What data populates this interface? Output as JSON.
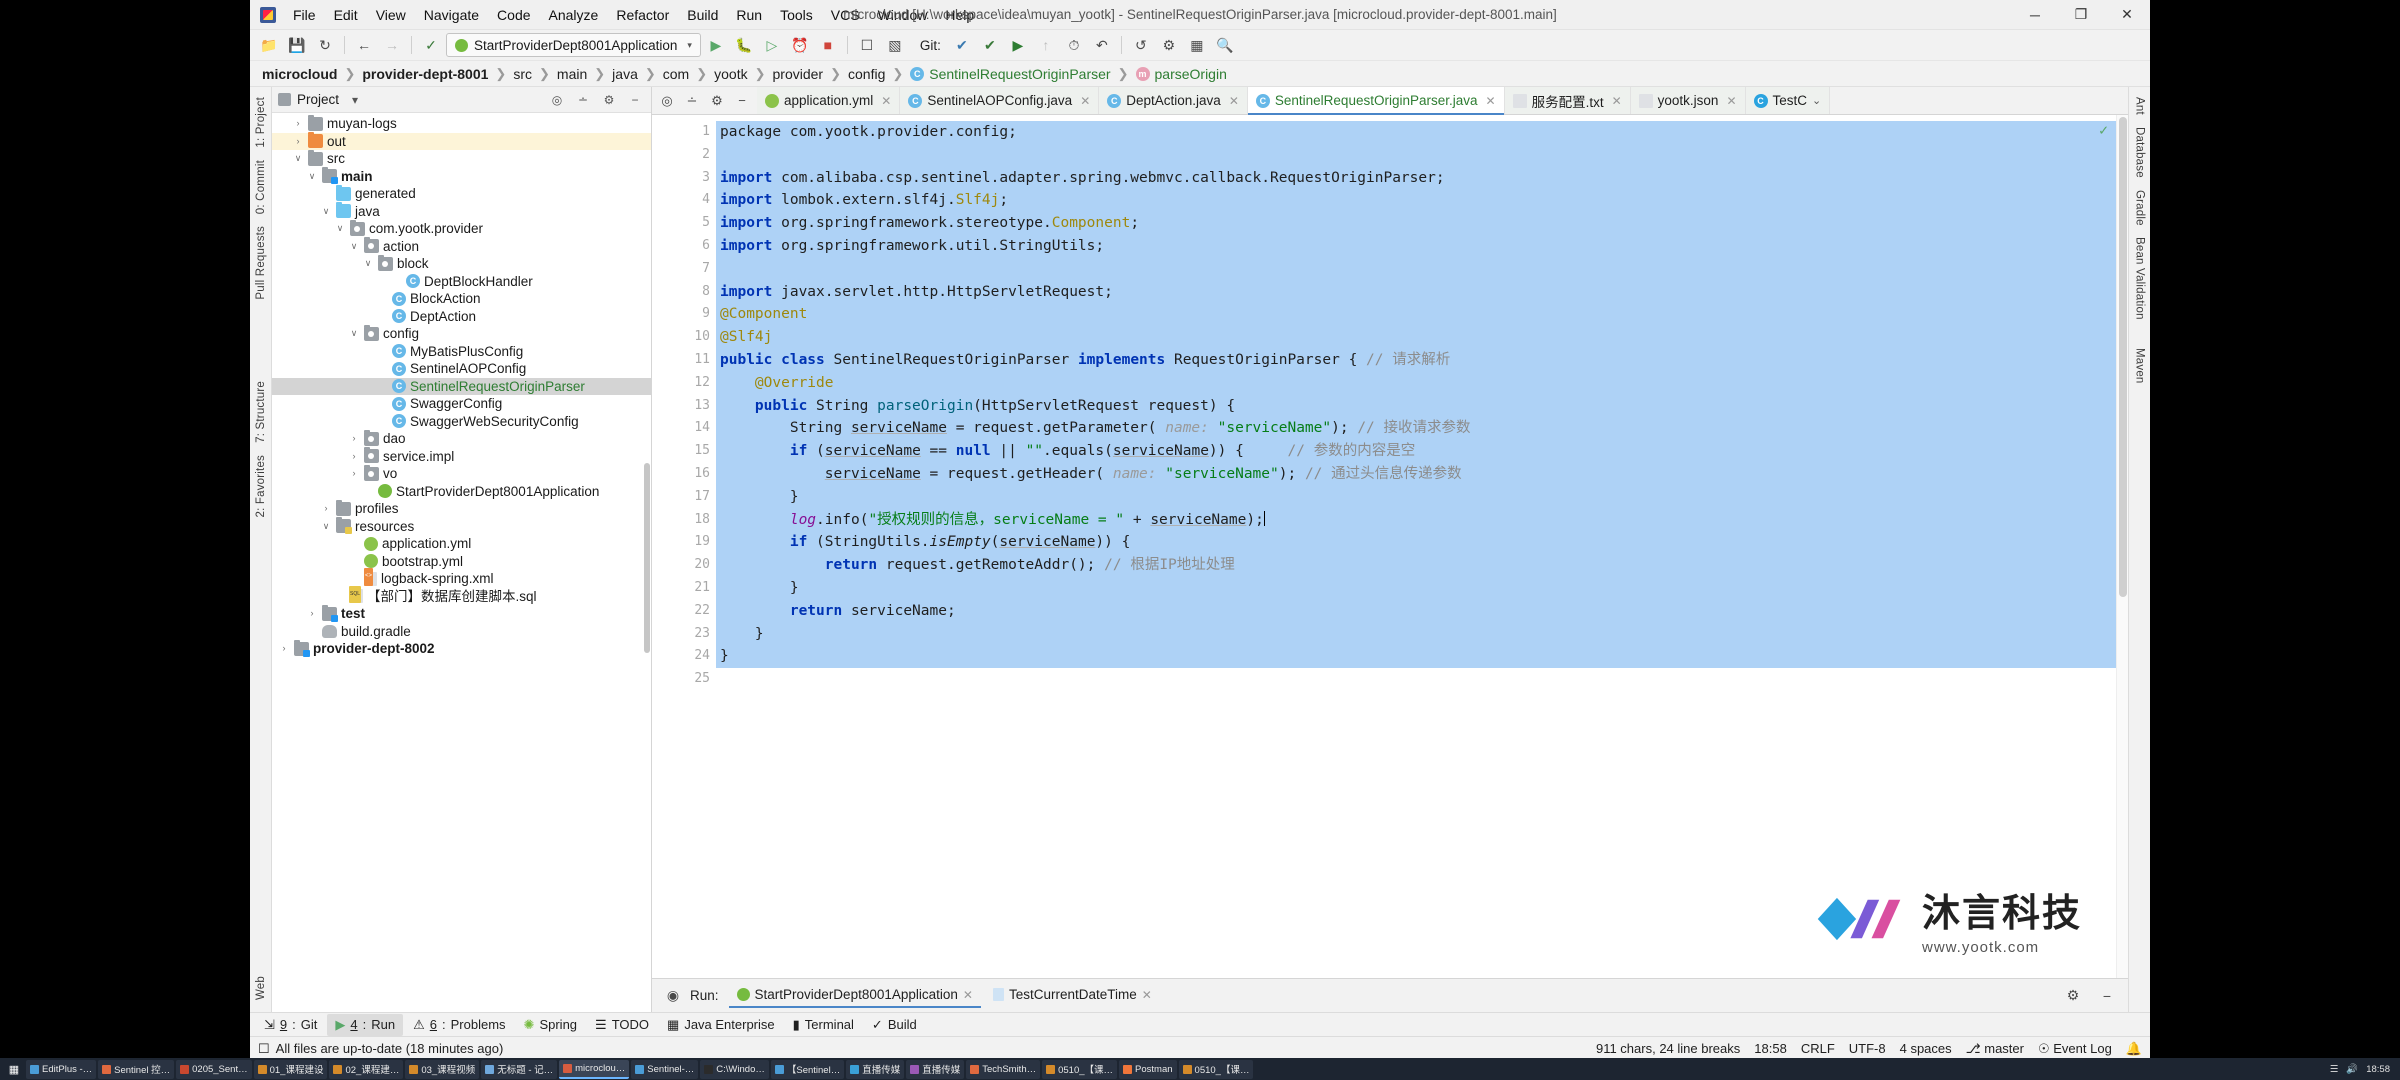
{
  "window": {
    "title": "microcloud [H:\\workspace\\idea\\muyan_yootk] - SentinelRequestOriginParser.java [microcloud.provider-dept-8001.main]",
    "minimize": "─",
    "maximize": "❐",
    "close": "✕"
  },
  "menu": [
    "File",
    "Edit",
    "View",
    "Navigate",
    "Code",
    "Analyze",
    "Refactor",
    "Build",
    "Run",
    "Tools",
    "VCS",
    "Window",
    "Help"
  ],
  "toolbar": {
    "run_config": "StartProviderDept8001Application",
    "git_label": "Git:",
    "caret": "▾"
  },
  "breadcrumb": [
    {
      "label": "microcloud",
      "bold": true
    },
    {
      "label": "provider-dept-8001",
      "bold": true
    },
    {
      "label": "src",
      "bold": false
    },
    {
      "label": "main",
      "bold": false
    },
    {
      "label": "java",
      "bold": false
    },
    {
      "label": "com",
      "bold": false
    },
    {
      "label": "yootk",
      "bold": false
    },
    {
      "label": "provider",
      "bold": false
    },
    {
      "label": "config",
      "bold": false
    },
    {
      "label": "SentinelRequestOriginParser",
      "bold": false,
      "icon": "class-icon"
    },
    {
      "label": "parseOrigin",
      "bold": false,
      "icon": "method-icon"
    }
  ],
  "left_rail": [
    "1: Project",
    "0: Commit",
    "Pull Requests",
    "7: Structure",
    "2: Favorites",
    "Web"
  ],
  "right_rail": [
    "Ant",
    "Database",
    "Gradle",
    "Bean Validation",
    "Maven"
  ],
  "project_panel": {
    "title": "Project",
    "caret": "▾",
    "tree": [
      {
        "indent": 1,
        "arrow": "›",
        "icon": "folder",
        "label": "muyan-logs",
        "state": "normal"
      },
      {
        "indent": 1,
        "arrow": "›",
        "icon": "folder-orange",
        "label": "out",
        "state": "highlight"
      },
      {
        "indent": 1,
        "arrow": "∨",
        "icon": "folder",
        "label": "src",
        "state": "normal"
      },
      {
        "indent": 2,
        "arrow": "∨",
        "icon": "folder-src",
        "label": "main",
        "state": "bold"
      },
      {
        "indent": 3,
        "arrow": "",
        "icon": "folder-generated",
        "label": "generated",
        "state": "normal"
      },
      {
        "indent": 3,
        "arrow": "∨",
        "icon": "folder-blue",
        "label": "java",
        "state": "normal"
      },
      {
        "indent": 4,
        "arrow": "∨",
        "icon": "folder-pkg",
        "label": "com.yootk.provider",
        "state": "normal"
      },
      {
        "indent": 5,
        "arrow": "∨",
        "icon": "folder-pkg",
        "label": "action",
        "state": "normal"
      },
      {
        "indent": 6,
        "arrow": "∨",
        "icon": "folder-pkg",
        "label": "block",
        "state": "normal"
      },
      {
        "indent": 8,
        "arrow": "",
        "icon": "class",
        "label": "DeptBlockHandler",
        "state": "normal"
      },
      {
        "indent": 7,
        "arrow": "",
        "icon": "class",
        "label": "BlockAction",
        "state": "normal"
      },
      {
        "indent": 7,
        "arrow": "",
        "icon": "class",
        "label": "DeptAction",
        "state": "normal"
      },
      {
        "indent": 5,
        "arrow": "∨",
        "icon": "folder-pkg",
        "label": "config",
        "state": "normal"
      },
      {
        "indent": 7,
        "arrow": "",
        "icon": "class",
        "label": "MyBatisPlusConfig",
        "state": "normal"
      },
      {
        "indent": 7,
        "arrow": "",
        "icon": "class",
        "label": "SentinelAOPConfig",
        "state": "normal"
      },
      {
        "indent": 7,
        "arrow": "",
        "icon": "class",
        "label": "SentinelRequestOriginParser",
        "state": "selected"
      },
      {
        "indent": 7,
        "arrow": "",
        "icon": "class",
        "label": "SwaggerConfig",
        "state": "normal"
      },
      {
        "indent": 7,
        "arrow": "",
        "icon": "class",
        "label": "SwaggerWebSecurityConfig",
        "state": "normal"
      },
      {
        "indent": 5,
        "arrow": "›",
        "icon": "folder-pkg",
        "label": "dao",
        "state": "normal"
      },
      {
        "indent": 5,
        "arrow": "›",
        "icon": "folder-pkg",
        "label": "service.impl",
        "state": "normal"
      },
      {
        "indent": 5,
        "arrow": "›",
        "icon": "folder-pkg",
        "label": "vo",
        "state": "normal"
      },
      {
        "indent": 6,
        "arrow": "",
        "icon": "spring",
        "label": "StartProviderDept8001Application",
        "state": "normal"
      },
      {
        "indent": 3,
        "arrow": "›",
        "icon": "folder",
        "label": "profiles",
        "state": "normal"
      },
      {
        "indent": 3,
        "arrow": "∨",
        "icon": "folder-res",
        "label": "resources",
        "state": "normal"
      },
      {
        "indent": 5,
        "arrow": "",
        "icon": "yml",
        "label": "application.yml",
        "state": "normal"
      },
      {
        "indent": 5,
        "arrow": "",
        "icon": "yml",
        "label": "bootstrap.yml",
        "state": "normal"
      },
      {
        "indent": 5,
        "arrow": "",
        "icon": "xml",
        "label": "logback-spring.xml",
        "state": "normal"
      },
      {
        "indent": 4,
        "arrow": "",
        "icon": "sql",
        "label": "【部门】数据库创建脚本.sql",
        "state": "normal"
      },
      {
        "indent": 2,
        "arrow": "›",
        "icon": "folder-src",
        "label": "test",
        "state": "bold"
      },
      {
        "indent": 2,
        "arrow": "",
        "icon": "gradle",
        "label": "build.gradle",
        "state": "normal"
      },
      {
        "indent": 0,
        "arrow": "›",
        "icon": "folder-src",
        "label": "provider-dept-8002",
        "state": "bold"
      }
    ]
  },
  "editor_tabs": [
    {
      "label": "application.yml",
      "icon": "yml-icon",
      "active": false,
      "green": false
    },
    {
      "label": "SentinelAOPConfig.java",
      "icon": "class-icon",
      "active": false,
      "green": false
    },
    {
      "label": "DeptAction.java",
      "icon": "class-icon",
      "active": false,
      "green": false
    },
    {
      "label": "SentinelRequestOriginParser.java",
      "icon": "class-icon",
      "active": true,
      "green": true
    },
    {
      "label": "服务配置.txt",
      "icon": "txt-icon",
      "active": false,
      "green": false
    },
    {
      "label": "yootk.json",
      "icon": "json-icon",
      "active": false,
      "green": false
    },
    {
      "label": "TestC",
      "icon": "testclass-icon",
      "active": false,
      "green": false
    }
  ],
  "code": {
    "first_visible_line": 1,
    "lines": [
      {
        "n": 1,
        "sel": true,
        "clipped": true,
        "tokens": [
          {
            "t": "package com.yootk.provider.config;",
            "c": "plain"
          }
        ]
      },
      {
        "n": 2,
        "sel": true,
        "tokens": []
      },
      {
        "n": 3,
        "sel": true,
        "fold": true,
        "tokens": [
          {
            "t": "import ",
            "c": "kw"
          },
          {
            "t": "com.alibaba.csp.sentinel.adapter.spring.webmvc.callback.RequestOriginParser;",
            "c": "plain"
          }
        ]
      },
      {
        "n": 4,
        "sel": true,
        "tokens": [
          {
            "t": "import ",
            "c": "kw"
          },
          {
            "t": "lombok.extern.slf4j.",
            "c": "plain"
          },
          {
            "t": "Slf4j",
            "c": "ann"
          },
          {
            "t": ";",
            "c": "plain"
          }
        ]
      },
      {
        "n": 5,
        "sel": true,
        "tokens": [
          {
            "t": "import ",
            "c": "kw"
          },
          {
            "t": "org.springframework.stereotype.",
            "c": "plain"
          },
          {
            "t": "Component",
            "c": "ann"
          },
          {
            "t": ";",
            "c": "plain"
          }
        ]
      },
      {
        "n": 6,
        "sel": true,
        "tokens": [
          {
            "t": "import ",
            "c": "kw"
          },
          {
            "t": "org.springframework.util.StringUtils;",
            "c": "plain"
          }
        ]
      },
      {
        "n": 7,
        "sel": true,
        "tokens": []
      },
      {
        "n": 8,
        "sel": true,
        "fold": true,
        "tokens": [
          {
            "t": "import ",
            "c": "kw"
          },
          {
            "t": "javax.servlet.http.HttpServletRequest;",
            "c": "plain"
          }
        ]
      },
      {
        "n": 9,
        "sel": true,
        "fold": true,
        "tokens": [
          {
            "t": "@Component",
            "c": "ann"
          }
        ]
      },
      {
        "n": 10,
        "sel": true,
        "fold": true,
        "tokens": [
          {
            "t": "@Slf4j",
            "c": "ann"
          }
        ]
      },
      {
        "n": 11,
        "sel": true,
        "marker": "class-marker",
        "tokens": [
          {
            "t": "public class ",
            "c": "kw"
          },
          {
            "t": "SentinelRequestOriginParser ",
            "c": "plain"
          },
          {
            "t": "implements ",
            "c": "kw"
          },
          {
            "t": "RequestOriginParser { ",
            "c": "plain"
          },
          {
            "t": "// 请求解析",
            "c": "cmt"
          }
        ]
      },
      {
        "n": 12,
        "sel": true,
        "tokens": [
          {
            "t": "    @Override",
            "c": "ann"
          }
        ]
      },
      {
        "n": 13,
        "sel": true,
        "marker": "override-marker",
        "fold": true,
        "tokens": [
          {
            "t": "    ",
            "c": "plain"
          },
          {
            "t": "public ",
            "c": "kw"
          },
          {
            "t": "String ",
            "c": "plain"
          },
          {
            "t": "parseOrigin",
            "c": "mth"
          },
          {
            "t": "(HttpServletRequest request) {",
            "c": "plain"
          }
        ]
      },
      {
        "n": 14,
        "sel": true,
        "tokens": [
          {
            "t": "        String ",
            "c": "plain"
          },
          {
            "t": "serviceName",
            "c": "und"
          },
          {
            "t": " = request.getParameter( ",
            "c": "plain"
          },
          {
            "t": "name:",
            "c": "hint"
          },
          {
            "t": " ",
            "c": "plain"
          },
          {
            "t": "\"serviceName\"",
            "c": "str"
          },
          {
            "t": "); ",
            "c": "plain"
          },
          {
            "t": "// 接收请求参数",
            "c": "cmt"
          }
        ]
      },
      {
        "n": 15,
        "sel": true,
        "tokens": [
          {
            "t": "        ",
            "c": "plain"
          },
          {
            "t": "if ",
            "c": "kw"
          },
          {
            "t": "(",
            "c": "plain"
          },
          {
            "t": "serviceName",
            "c": "und"
          },
          {
            "t": " == ",
            "c": "plain"
          },
          {
            "t": "null",
            "c": "kw"
          },
          {
            "t": " || ",
            "c": "plain"
          },
          {
            "t": "\"\"",
            "c": "str"
          },
          {
            "t": ".equals(",
            "c": "plain"
          },
          {
            "t": "serviceName",
            "c": "und"
          },
          {
            "t": ")) {     ",
            "c": "plain"
          },
          {
            "t": "// 参数的内容是空",
            "c": "cmt"
          }
        ]
      },
      {
        "n": 16,
        "sel": true,
        "tokens": [
          {
            "t": "            ",
            "c": "plain"
          },
          {
            "t": "serviceName",
            "c": "und"
          },
          {
            "t": " = request.getHeader( ",
            "c": "plain"
          },
          {
            "t": "name:",
            "c": "hint"
          },
          {
            "t": " ",
            "c": "plain"
          },
          {
            "t": "\"serviceName\"",
            "c": "str"
          },
          {
            "t": "); ",
            "c": "plain"
          },
          {
            "t": "// 通过头信息传递参数",
            "c": "cmt"
          }
        ]
      },
      {
        "n": 17,
        "sel": true,
        "tokens": [
          {
            "t": "        }",
            "c": "plain"
          }
        ]
      },
      {
        "n": 18,
        "sel": true,
        "current": true,
        "tokens": [
          {
            "t": "        ",
            "c": "plain"
          },
          {
            "t": "log",
            "c": "fld-ital"
          },
          {
            "t": ".info(",
            "c": "plain"
          },
          {
            "t": "\"授权规则的信息，serviceName = \"",
            "c": "str"
          },
          {
            "t": " + ",
            "c": "plain"
          },
          {
            "t": "serviceName",
            "c": "und"
          },
          {
            "t": ");",
            "c": "plain"
          },
          {
            "t": "|",
            "c": "caret"
          }
        ]
      },
      {
        "n": 19,
        "sel": true,
        "tokens": [
          {
            "t": "        ",
            "c": "plain"
          },
          {
            "t": "if ",
            "c": "kw"
          },
          {
            "t": "(StringUtils.",
            "c": "plain"
          },
          {
            "t": "isEmpty",
            "c": "ital"
          },
          {
            "t": "(",
            "c": "plain"
          },
          {
            "t": "serviceName",
            "c": "und"
          },
          {
            "t": ")) {",
            "c": "plain"
          }
        ]
      },
      {
        "n": 20,
        "sel": true,
        "tokens": [
          {
            "t": "            ",
            "c": "plain"
          },
          {
            "t": "return ",
            "c": "kw"
          },
          {
            "t": "request.getRemoteAddr(); ",
            "c": "plain"
          },
          {
            "t": "// 根据IP地址处理",
            "c": "cmt"
          }
        ]
      },
      {
        "n": 21,
        "sel": true,
        "tokens": [
          {
            "t": "        }",
            "c": "plain"
          }
        ]
      },
      {
        "n": 22,
        "sel": true,
        "tokens": [
          {
            "t": "        ",
            "c": "plain"
          },
          {
            "t": "return ",
            "c": "kw"
          },
          {
            "t": "serviceName;",
            "c": "plain"
          }
        ]
      },
      {
        "n": 23,
        "sel": true,
        "tokens": [
          {
            "t": "    }",
            "c": "plain"
          }
        ]
      },
      {
        "n": 24,
        "sel": true,
        "tokens": [
          {
            "t": "}",
            "c": "plain"
          }
        ]
      },
      {
        "n": 25,
        "sel": false,
        "tokens": []
      }
    ]
  },
  "watermark": {
    "cn": "沐言科技",
    "en": "www.yootk.com"
  },
  "run_panel": {
    "label": "Run:",
    "tabs": [
      {
        "label": "StartProviderDept8001Application",
        "active": true,
        "icon": "spring-icon"
      },
      {
        "label": "TestCurrentDateTime",
        "active": false,
        "icon": "test-icon"
      }
    ]
  },
  "tool_window_bar": [
    {
      "num": "9",
      "label": "Git",
      "icon": "git-icon",
      "active": false
    },
    {
      "num": "4",
      "label": "Run",
      "icon": "run-icon",
      "active": true
    },
    {
      "num": "6",
      "label": "Problems",
      "icon": "problems-icon",
      "active": false
    },
    {
      "num": "",
      "label": "Spring",
      "icon": "spring-icon",
      "active": false
    },
    {
      "num": "",
      "label": "TODO",
      "icon": "todo-icon",
      "active": false
    },
    {
      "num": "",
      "label": "Java Enterprise",
      "icon": "java-ee-icon",
      "active": false
    },
    {
      "num": "",
      "label": "Terminal",
      "icon": "terminal-icon",
      "active": false
    },
    {
      "num": "",
      "label": "Build",
      "icon": "build-icon",
      "active": false
    }
  ],
  "status_bar": {
    "message": "All files are up-to-date (18 minutes ago)",
    "chars": "911 chars, 24 line breaks",
    "time": "18:58",
    "line_sep": "CRLF",
    "encoding": "UTF-8",
    "indent": "4 spaces",
    "branch": "master",
    "event_log": "Event Log"
  },
  "taskbar": {
    "items": [
      {
        "label": "EditPlus -…",
        "color": "#4a9cd6",
        "active": false
      },
      {
        "label": "Sentinel 控…",
        "color": "#e0693f",
        "active": false
      },
      {
        "label": "0205_Sent…",
        "color": "#c9482f",
        "active": false
      },
      {
        "label": "01_课程建设",
        "color": "#d48a2a",
        "active": false
      },
      {
        "label": "02_课程建…",
        "color": "#d48a2a",
        "active": false
      },
      {
        "label": "03_课程视频",
        "color": "#d48a2a",
        "active": false
      },
      {
        "label": "无标题 - 记…",
        "color": "#6fa8dc",
        "active": false
      },
      {
        "label": "microclou…",
        "color": "#d65c3f",
        "active": true
      },
      {
        "label": "Sentinel-…",
        "color": "#4a9cd6",
        "active": false
      },
      {
        "label": "C:\\Windo…",
        "color": "#2b2b2b",
        "active": false
      },
      {
        "label": "【Sentinel…",
        "color": "#4a9cd6",
        "active": false
      },
      {
        "label": "直播传媒",
        "color": "#3aa0d6",
        "active": false
      },
      {
        "label": "直播传媒",
        "color": "#9b59b6",
        "active": false
      },
      {
        "label": "TechSmith…",
        "color": "#e0693f",
        "active": false
      },
      {
        "label": "0510_【课…",
        "color": "#d48a2a",
        "active": false
      },
      {
        "label": "Postman",
        "color": "#f0763a",
        "active": false
      },
      {
        "label": "0510_【课…",
        "color": "#d48a2a",
        "active": false
      }
    ],
    "clock": "18:58"
  }
}
